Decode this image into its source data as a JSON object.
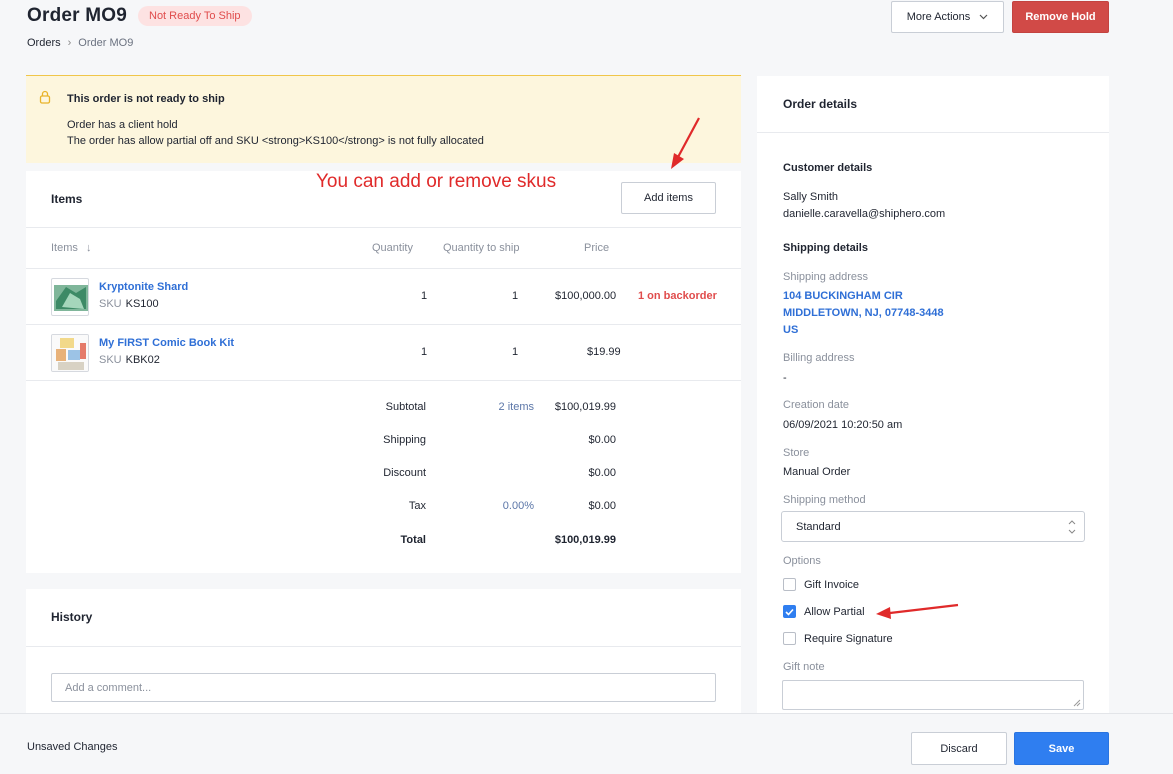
{
  "header": {
    "title": "Order MO9",
    "status": "Not Ready To Ship",
    "breadcrumb": {
      "root": "Orders",
      "current": "Order MO9"
    },
    "more_actions_label": "More Actions",
    "remove_hold_label": "Remove Hold"
  },
  "alert": {
    "title": "This order is not ready to ship",
    "lines": [
      "Order has a client hold",
      "The order has allow partial off and SKU <strong>KS100</strong> is not fully allocated"
    ]
  },
  "annotations": {
    "items_note": "You can add or remove skus"
  },
  "items": {
    "title": "Items",
    "add_items_label": "Add items",
    "columns": {
      "items": "Items",
      "quantity": "Quantity",
      "quantity_to_ship": "Quantity to ship",
      "price": "Price"
    },
    "rows": [
      {
        "name": "Kryptonite Shard",
        "sku_label": "SKU",
        "sku": "KS100",
        "quantity": "1",
        "to_ship": "1",
        "price": "$100,000.00",
        "status": "1 on backorder"
      },
      {
        "name": "My FIRST Comic Book Kit",
        "sku_label": "SKU",
        "sku": "KBK02",
        "quantity": "1",
        "to_ship": "1",
        "price": "$19.99",
        "status": ""
      }
    ],
    "summary": {
      "subtotal_label": "Subtotal",
      "subtotal_count": "2 items",
      "subtotal_value": "$100,019.99",
      "shipping_label": "Shipping",
      "shipping_value": "$0.00",
      "discount_label": "Discount",
      "discount_value": "$0.00",
      "tax_label": "Tax",
      "tax_rate": "0.00%",
      "tax_value": "$0.00",
      "total_label": "Total",
      "total_value": "$100,019.99"
    }
  },
  "history": {
    "title": "History",
    "comment_placeholder": "Add a comment..."
  },
  "details": {
    "title": "Order details",
    "customer_heading": "Customer details",
    "customer_name": "Sally Smith",
    "customer_email": "danielle.caravella@shiphero.com",
    "shipping_heading": "Shipping details",
    "shipping_address_label": "Shipping address",
    "shipping_address": [
      "104 BUCKINGHAM CIR",
      "MIDDLETOWN, NJ, 07748-3448",
      "US"
    ],
    "billing_address_label": "Billing address",
    "billing_address": "-",
    "creation_date_label": "Creation date",
    "creation_date": "06/09/2021 10:20:50 am",
    "store_label": "Store",
    "store": "Manual Order",
    "shipping_method_label": "Shipping method",
    "shipping_method": "Standard",
    "options_label": "Options",
    "options": [
      {
        "label": "Gift Invoice",
        "checked": false
      },
      {
        "label": "Allow Partial",
        "checked": true
      },
      {
        "label": "Require Signature",
        "checked": false
      }
    ],
    "gift_note_label": "Gift note"
  },
  "footer": {
    "unsaved_label": "Unsaved Changes",
    "discard_label": "Discard",
    "save_label": "Save"
  },
  "colors": {
    "primary": "#2f7ef0",
    "danger": "#d14a47",
    "link": "#2f6fd6",
    "alert_bg": "#fdf6dd",
    "annotation": "#e02a2a"
  }
}
